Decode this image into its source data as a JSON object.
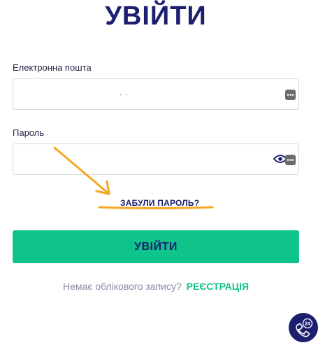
{
  "page": {
    "title": "УВІЙТИ"
  },
  "email": {
    "label": "Електронна пошта",
    "value": "",
    "visible_text": ". ."
  },
  "password": {
    "label": "Пароль",
    "value": ""
  },
  "forgot_password": {
    "label": "ЗАБУЛИ ПАРОЛЬ?"
  },
  "login_button": {
    "label": "УВІЙТИ"
  },
  "signup": {
    "prompt": "Немає облікового запису?",
    "link_label": "РЕЄСТРАЦІЯ"
  },
  "support": {
    "badge": "24"
  },
  "colors": {
    "brand_navy": "#1b1f6e",
    "accent_green": "#0fc48a",
    "annotation_arrow": "#f5a623"
  }
}
